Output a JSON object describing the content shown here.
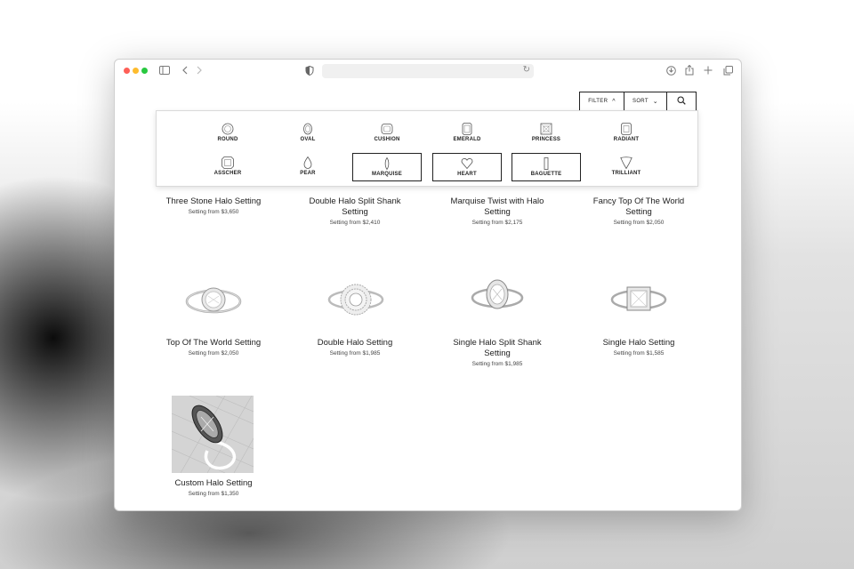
{
  "browser": {
    "traffic_lights": [
      "close",
      "minimize",
      "zoom"
    ],
    "icons": [
      "sidebar-icon",
      "back-icon",
      "forward-icon",
      "shield-icon",
      "reload-icon",
      "download-icon",
      "share-icon",
      "new-tab-icon",
      "tabs-icon"
    ]
  },
  "controls": {
    "filter_label": "FILTER",
    "sort_label": "SORT"
  },
  "shapes": [
    {
      "label": "ROUND",
      "icon": "round-diamond-icon",
      "selected": false
    },
    {
      "label": "OVAL",
      "icon": "oval-diamond-icon",
      "selected": false
    },
    {
      "label": "CUSHION",
      "icon": "cushion-diamond-icon",
      "selected": false
    },
    {
      "label": "EMERALD",
      "icon": "emerald-diamond-icon",
      "selected": false
    },
    {
      "label": "PRINCESS",
      "icon": "princess-diamond-icon",
      "selected": false
    },
    {
      "label": "RADIANT",
      "icon": "radiant-diamond-icon",
      "selected": false
    },
    {
      "label": "ASSCHER",
      "icon": "asscher-diamond-icon",
      "selected": false
    },
    {
      "label": "PEAR",
      "icon": "pear-diamond-icon",
      "selected": false
    },
    {
      "label": "MARQUISE",
      "icon": "marquise-diamond-icon",
      "selected": true
    },
    {
      "label": "HEART",
      "icon": "heart-diamond-icon",
      "selected": true
    },
    {
      "label": "BAGUETTE",
      "icon": "baguette-diamond-icon",
      "selected": true
    },
    {
      "label": "TRILLIANT",
      "icon": "trilliant-diamond-icon",
      "selected": false
    }
  ],
  "products": [
    {
      "name": "Three Stone Halo Setting",
      "price": "Setting from $3,650"
    },
    {
      "name": "Double Halo Split Shank Setting",
      "price": "Setting from $2,410"
    },
    {
      "name": "Marquise Twist with Halo Setting",
      "price": "Setting from $2,175"
    },
    {
      "name": "Fancy Top Of The World Setting",
      "price": "Setting from $2,050"
    },
    {
      "name": "Top Of The World Setting",
      "price": "Setting from $2,050"
    },
    {
      "name": "Double Halo Setting",
      "price": "Setting from $1,985"
    },
    {
      "name": "Single Halo Split Shank Setting",
      "price": "Setting from $1,985"
    },
    {
      "name": "Single Halo Setting",
      "price": "Setting from $1,585"
    },
    {
      "name": "Custom Halo Setting",
      "price": "Setting from $1,350"
    }
  ]
}
